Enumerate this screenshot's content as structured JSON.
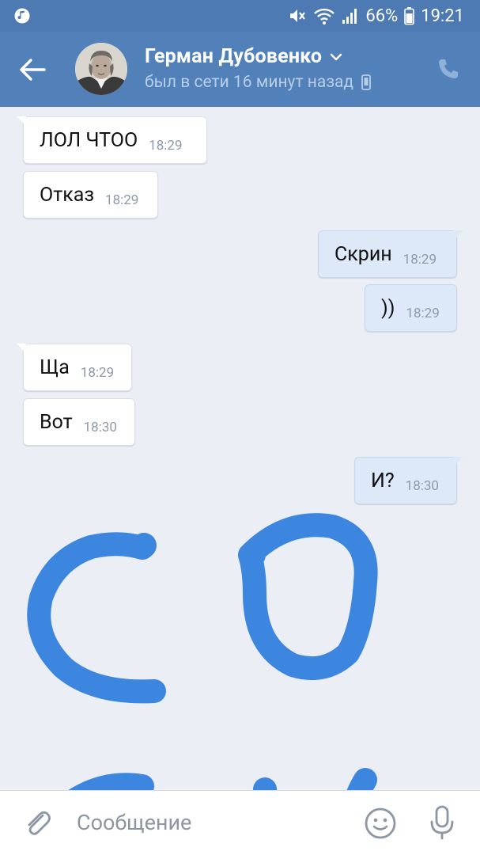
{
  "status_bar": {
    "battery_percent": "66%",
    "time": "19:21",
    "icons": [
      "music-note-icon",
      "mute-icon",
      "wifi-icon",
      "signal-icon",
      "battery-icon"
    ]
  },
  "header": {
    "contact_name": "Герман Дубовенко",
    "contact_status": "был в сети 16 минут назад",
    "icons": [
      "back-arrow-icon",
      "chevron-down-icon",
      "mobile-device-icon",
      "phone-icon"
    ],
    "colors": {
      "header_bg": "#5181b8",
      "status_bar_bg": "#4e7ab3"
    }
  },
  "messages": [
    {
      "direction": "in",
      "text": "ЛОЛ ЧТОО",
      "time": "18:29"
    },
    {
      "direction": "in",
      "text": "Отказ",
      "time": "18:29"
    },
    {
      "direction": "out",
      "text": "Скрин",
      "time": "18:29"
    },
    {
      "direction": "out",
      "text": "))",
      "time": "18:29"
    },
    {
      "direction": "in",
      "text": "Ща",
      "time": "18:29"
    },
    {
      "direction": "in",
      "text": "Вот",
      "time": "18:30"
    },
    {
      "direction": "out",
      "text": "И?",
      "time": "18:30"
    }
  ],
  "drawing": {
    "description_color": "#3d86e0"
  },
  "composer": {
    "placeholder": "Сообщение",
    "value": "",
    "icons": [
      "paperclip-icon",
      "emoji-icon",
      "microphone-icon"
    ]
  }
}
